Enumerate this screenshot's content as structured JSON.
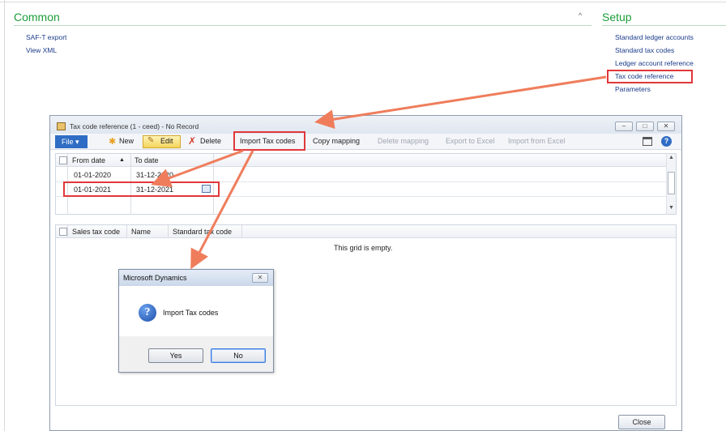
{
  "area_page": {
    "common": {
      "title": "Common",
      "links": [
        "SAF-T export",
        "View XML"
      ]
    },
    "setup": {
      "title": "Setup",
      "links": [
        "Standard ledger accounts",
        "Standard tax codes",
        "Ledger account reference",
        "Tax code reference",
        "Parameters"
      ]
    }
  },
  "form": {
    "title": "Tax code reference (1 - ceed) - No Record",
    "toolbar": {
      "file": "File",
      "new": "New",
      "edit": "Edit",
      "delete": "Delete",
      "import_tax_codes": "Import Tax codes",
      "copy_mapping": "Copy mapping",
      "delete_mapping": "Delete mapping",
      "export_to_excel": "Export to Excel",
      "import_from_excel": "Import from Excel"
    },
    "top_grid": {
      "columns": [
        "From date",
        "To date"
      ],
      "rows": [
        [
          "01-01-2020",
          "31-12-2020"
        ],
        [
          "01-01-2021",
          "31-12-2021"
        ]
      ]
    },
    "bottom_grid": {
      "columns": [
        "Sales tax code",
        "Name",
        "Standard tax code"
      ],
      "empty_message": "This grid is empty."
    },
    "close": "Close"
  },
  "dialog": {
    "title": "Microsoft Dynamics",
    "message": "Import Tax codes",
    "yes": "Yes",
    "no": "No"
  },
  "colors": {
    "section_title": "#1e9c3a",
    "link": "#1a3b8a",
    "annotation": "#e0383a",
    "arrow": "#ef7d5c"
  }
}
